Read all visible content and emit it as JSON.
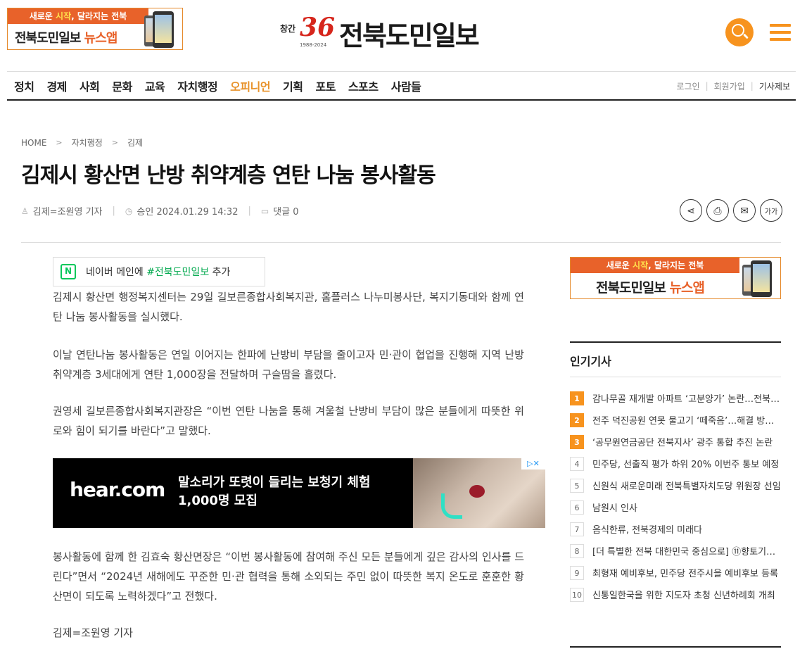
{
  "banner": {
    "line1_pre": "새로운 ",
    "line1_hl": "시작",
    "line1_post": ", 달라지는 전북",
    "line2_pre": "전북도민일보 ",
    "line2_accent": "뉴스앱"
  },
  "logo": {
    "prefix": "창간",
    "number": "36",
    "years": "1988-2024",
    "name": "전북도민일보"
  },
  "nav": {
    "items": [
      "정치",
      "경제",
      "사회",
      "문화",
      "교육",
      "자치행정",
      "오피니언",
      "기획",
      "포토",
      "스포츠",
      "사람들"
    ],
    "active": "오피니언",
    "login": "로그인",
    "signup": "회원가입",
    "report": "기사제보"
  },
  "breadcrumb": {
    "home": "HOME",
    "level1": "자치행정",
    "level2": "김제"
  },
  "article": {
    "title": "김제시 황산면 난방 취약계층 연탄 나눔 봉사활동",
    "author": "김제=조원영 기자",
    "approved": "승인 2024.01.29 14:32",
    "comments": "댓글 0",
    "naver_pre": "네이버 메인에 ",
    "naver_tag": "#전북도민일보",
    "naver_post": " 추가",
    "p1": "김제시 황산면 행정복지센터는 29일 길보른종합사회복지관, 홈플러스 나누미봉사단, 복지기동대와 함께 연탄 나눔 봉사활동을 실시했다.",
    "p2": "이날 연탄나눔 봉사활동은 연일 이어지는 한파에 난방비 부담을 줄이고자 민·관이 협업을 진행해 지역 난방 취약계층 3세대에게 연탄 1,000장을 전달하며 구슬땀을 흘렸다.",
    "p3": "권영세 길보른종합사회복지관장은 “이번 연탄 나눔을 통해 겨울철 난방비 부담이 많은 분들에게 따뜻한 위로와 힘이 되기를 바란다”고 말했다.",
    "p4": "봉사활동에 함께 한 김효숙 황산면장은 “이번 봉사활동에 참여해 주신 모든 분들에게 깊은 감사의 인사를 드린다”면서 “2024년 새해에도 꾸준한 민·관 협력을 통해 소외되는 주민 없이 따뜻한 복지 온도로 훈훈한 황산면이 되도록 노력하겠다”고 전했다.",
    "p5": "김제=조원영 기자"
  },
  "ad": {
    "logo": "hear.com",
    "line1": "말소리가 또렷이 들리는 보청기 체험",
    "line2": "1,000명 모집",
    "close": "▷✕"
  },
  "popular": {
    "title": "인기기사",
    "items": [
      {
        "rank": "1",
        "text": "감나무골 재개발 아파트 ‘고분양가’ 논란…전북 최고가 될 듯"
      },
      {
        "rank": "2",
        "text": "전주 덕진공원 연못 물고기 ‘떼죽음’…해결 방안은"
      },
      {
        "rank": "3",
        "text": "‘공무원연금공단 전북지사’ 광주 통합 추진 논란"
      },
      {
        "rank": "4",
        "text": "민주당, 선출직 평가 하위 20% 이번주 통보 예정"
      },
      {
        "rank": "5",
        "text": "신원식 새로운미래 전북특별자치도당 위원장 선임"
      },
      {
        "rank": "6",
        "text": "남원시 인사"
      },
      {
        "rank": "7",
        "text": "음식한류, 전북경제의 미래다"
      },
      {
        "rank": "8",
        "text": "[더 특별한 전북 대한민국 중심으로] ⑪향토기업 육성"
      },
      {
        "rank": "9",
        "text": "최형재 예비후보, 민주당 전주시을 예비후보 등록"
      },
      {
        "rank": "10",
        "text": "신통일한국을 위한 지도자 초청 신년하례회 개최"
      }
    ]
  },
  "colors": {
    "accent": "#f7931e",
    "nav_active": "#e8922a",
    "naver_green": "#03c75a"
  }
}
